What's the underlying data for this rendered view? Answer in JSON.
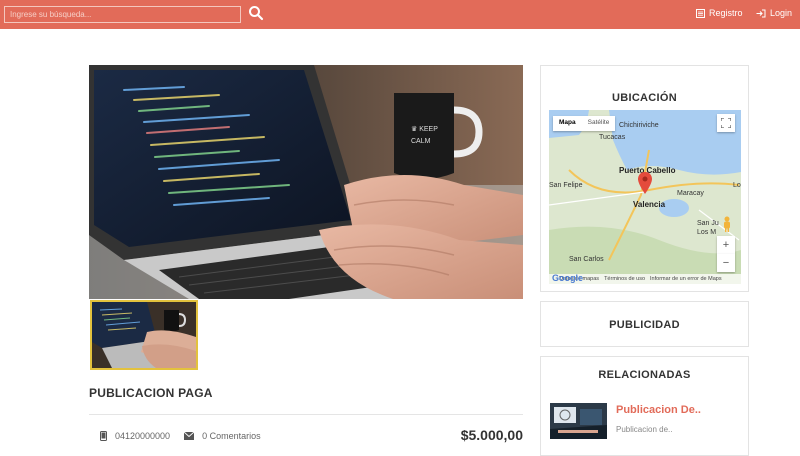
{
  "header": {
    "search_placeholder": "Ingrese su búsqueda...",
    "registro_label": "Registro",
    "login_label": "Login",
    "bar_color": "#e26b59"
  },
  "post": {
    "title": "PUBLICACION PAGA",
    "phone": "04120000000",
    "comments": "0 Comentarios",
    "price": "$5.000,00"
  },
  "sidebar": {
    "ubicacion_title": "UBICACIÓN",
    "publicidad_title": "PUBLICIDAD",
    "relacionadas_title": "RELACIONADAS",
    "related": {
      "title": "Publicacion De..",
      "description": "Publicacion de.."
    }
  },
  "map": {
    "tab_map": "Mapa",
    "tab_satellite": "Satélite",
    "labels": {
      "chichiriviche": "Chichiriviche",
      "tucacas": "Tucacas",
      "puerto_cabello": "Puerto Cabello",
      "san_felipe": "San Felipe",
      "maracay": "Maracay",
      "valencia": "Valencia",
      "san_juan": "San Ju",
      "los_m": "Los M",
      "san_carlos": "San Carlos",
      "lo": "Lo"
    },
    "footer": {
      "data": "Datos de mapas",
      "terms": "Términos de uso",
      "report": "Informar de un error de Maps"
    },
    "google": "Google"
  }
}
